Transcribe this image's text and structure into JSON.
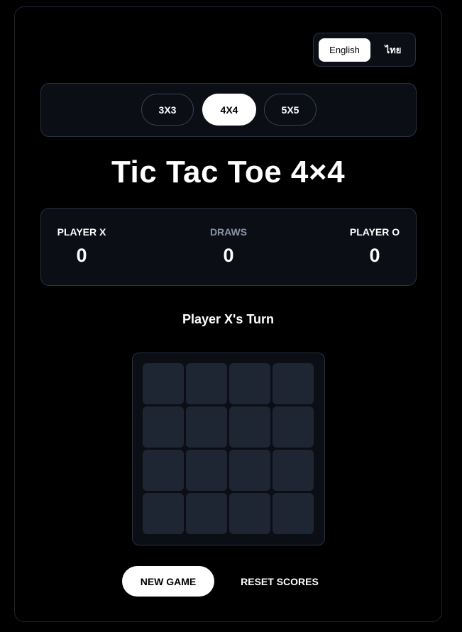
{
  "language": {
    "options": [
      "English",
      "ไทย"
    ],
    "selected": "English"
  },
  "board_sizes": {
    "options": [
      "3X3",
      "4X4",
      "5X5"
    ],
    "selected": "4X4"
  },
  "title": "Tic Tac Toe 4×4",
  "scores": {
    "player_x": {
      "label": "PLAYER X",
      "value": "0"
    },
    "draws": {
      "label": "DRAWS",
      "value": "0"
    },
    "player_o": {
      "label": "PLAYER O",
      "value": "0"
    }
  },
  "status": "Player X's Turn",
  "board": {
    "rows": 4,
    "cols": 4,
    "cells": [
      "",
      "",
      "",
      "",
      "",
      "",
      "",
      "",
      "",
      "",
      "",
      "",
      "",
      "",
      "",
      ""
    ]
  },
  "actions": {
    "new_game": "NEW GAME",
    "reset_scores": "RESET SCORES"
  },
  "colors": {
    "background": "#000000",
    "panel": "#0b0e15",
    "panel_border": "#2a3040",
    "cell": "#1f2633",
    "accent": "#ffffff",
    "muted_text": "#8a93a6"
  }
}
